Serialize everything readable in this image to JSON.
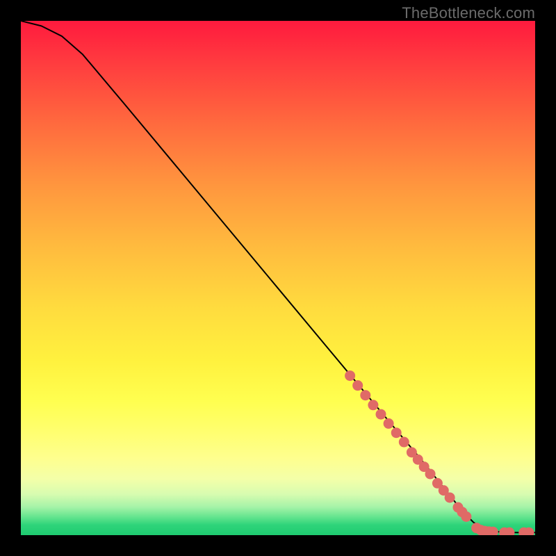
{
  "watermark": "TheBottleneck.com",
  "chart_data": {
    "type": "line",
    "title": "",
    "xlabel": "",
    "ylabel": "",
    "xlim": [
      0,
      100
    ],
    "ylim": [
      0,
      100
    ],
    "grid": false,
    "series": [
      {
        "name": "curve",
        "x": [
          0,
          4,
          8,
          12,
          20,
          30,
          40,
          50,
          60,
          70,
          78,
          84,
          86,
          88,
          90,
          92,
          96,
          100
        ],
        "y": [
          100,
          99,
          97,
          93.5,
          84,
          72,
          60,
          48,
          36,
          24,
          14.5,
          7,
          4.5,
          2.5,
          1.2,
          0.7,
          0.5,
          0.5
        ]
      }
    ],
    "markers": [
      {
        "name": "segment-a",
        "x": [
          64,
          65.5,
          67,
          68.5,
          70,
          71.5,
          73,
          74.5
        ],
        "y": [
          31,
          29.1,
          27.2,
          25.3,
          23.5,
          21.7,
          19.9,
          18.1
        ]
      },
      {
        "name": "segment-b",
        "x": [
          76,
          77.2,
          78.4,
          79.6
        ],
        "y": [
          16.1,
          14.7,
          13.3,
          11.9
        ]
      },
      {
        "name": "segment-c",
        "x": [
          81,
          82.2,
          83.4
        ],
        "y": [
          10.1,
          8.7,
          7.3
        ]
      },
      {
        "name": "segment-d",
        "x": [
          85,
          85.8,
          86.6
        ],
        "y": [
          5.4,
          4.5,
          3.6
        ]
      },
      {
        "name": "segment-e",
        "x": [
          88.6,
          89.4,
          90.2,
          91.0,
          91.8
        ],
        "y": [
          1.4,
          1.0,
          0.8,
          0.7,
          0.65
        ]
      },
      {
        "name": "segment-f",
        "x": [
          94.0,
          95.0
        ],
        "y": [
          0.5,
          0.5
        ]
      },
      {
        "name": "segment-g",
        "x": [
          97.8,
          98.8
        ],
        "y": [
          0.5,
          0.5
        ]
      }
    ],
    "colors": {
      "curve": "#000000",
      "marker_fill": "#e06a66",
      "marker_stroke": "#c94f4b"
    }
  }
}
